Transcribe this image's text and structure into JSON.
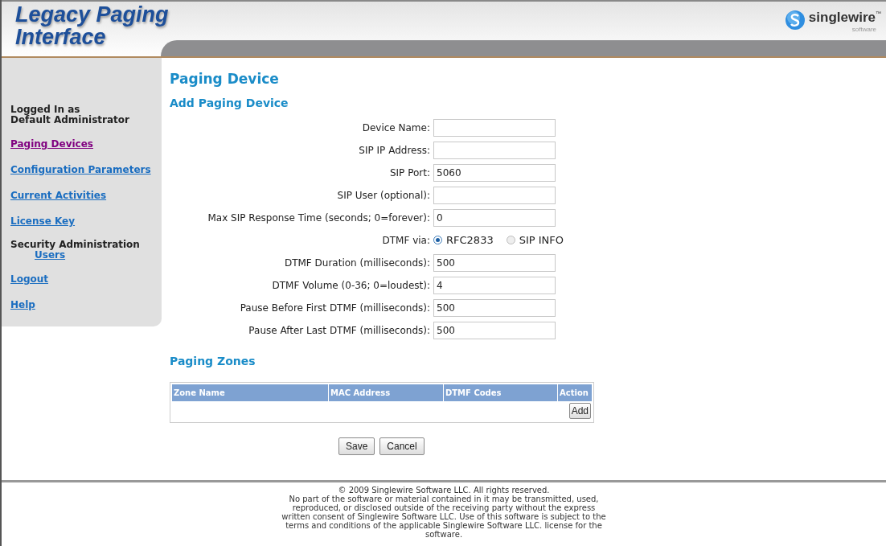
{
  "header": {
    "title_line_1": "Legacy Paging",
    "title_line_2": "Interface",
    "logo_text": "singlewire",
    "logo_mark": "™",
    "logo_subtext": "software"
  },
  "sidebar": {
    "login_lines": [
      "Logged In as",
      "Default Administrator"
    ],
    "items": [
      {
        "kind": "link",
        "label": "Paging Devices",
        "selected": true
      },
      {
        "kind": "link",
        "label": "Configuration Parameters",
        "selected": false
      },
      {
        "kind": "link",
        "label": "Current Activities",
        "selected": false
      },
      {
        "kind": "link",
        "label": "License Key",
        "selected": false
      },
      {
        "kind": "heading",
        "label": "Security Administration",
        "children": [
          {
            "label": "Users",
            "selected": false
          }
        ]
      },
      {
        "kind": "link",
        "label": "Logout",
        "selected": false
      },
      {
        "kind": "link",
        "label": "Help",
        "selected": false
      }
    ]
  },
  "page_title": "Paging Device",
  "section_title": "Add Paging Device",
  "form": [
    {
      "kind": "text",
      "label": "Device Name:"
    },
    {
      "kind": "text",
      "label": "SIP IP Address:"
    },
    {
      "kind": "text",
      "label": "SIP Port:",
      "value": "5060"
    },
    {
      "kind": "text",
      "label": "SIP User (optional):"
    },
    {
      "kind": "text",
      "label": "Max SIP Response Time (seconds; 0=forever):",
      "value": "0"
    },
    {
      "kind": "radio",
      "label": "DTMF via:",
      "options": [
        {
          "label": "RFC2833",
          "selected": true
        },
        {
          "label": "SIP INFO",
          "selected": false
        }
      ]
    },
    {
      "kind": "text",
      "label": "DTMF Duration (milliseconds):",
      "value": "500"
    },
    {
      "kind": "text",
      "label": "DTMF Volume (0-36; 0=loudest):",
      "value": "4"
    },
    {
      "kind": "text",
      "label": "Pause Before First DTMF (milliseconds):",
      "value": "500"
    },
    {
      "kind": "text",
      "label": "Pause After Last DTMF (milliseconds):",
      "value": "500"
    }
  ],
  "zones": {
    "title": "Paging Zones",
    "columns": [
      "Zone Name",
      "MAC Address",
      "DTMF Codes",
      "Action"
    ],
    "add_button": "Add"
  },
  "buttons": [
    "Save",
    "Cancel"
  ],
  "footer": {
    "copyright": "© 2009 Singlewire Software LLC. All rights reserved.",
    "notice": "No part of the software or material contained in it may be transmitted, used, reproduced, or disclosed outside of the receiving party without the express written consent of Singlewire Software LLC. Use of this software is subject to the terms and conditions of the applicable Singlewire Software LLC. license for the software."
  }
}
